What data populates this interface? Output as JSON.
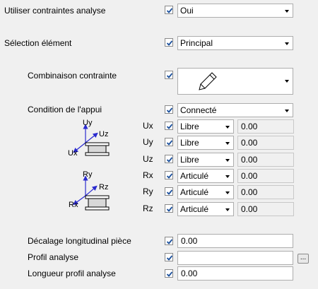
{
  "rows": {
    "use_constraints": {
      "label": "Utiliser contraintes analyse",
      "value": "Oui"
    },
    "element_selection": {
      "label": "Sélection élément",
      "value": "Principal"
    },
    "constraint_combination": {
      "label": "Combinaison contrainte",
      "icon": "pencil-icon"
    },
    "support_condition": {
      "label": "Condition de l'appui",
      "value": "Connecté"
    },
    "longitudinal_offset": {
      "label": "Décalage longitudinal pièce",
      "value": "0.00"
    },
    "analysis_profile": {
      "label": "Profil analyse",
      "value": "",
      "button": "..."
    },
    "analysis_profile_length": {
      "label": "Longueur profil analyse",
      "value": "0.00"
    }
  },
  "diagrams": {
    "translation": {
      "up": "Uy",
      "diag": "Uz",
      "left": "Ux"
    },
    "rotation": {
      "up": "Ry",
      "diag": "Rz",
      "left": "Rx"
    }
  },
  "dofs": [
    {
      "name": "Ux",
      "value": "Libre",
      "number": "0.00"
    },
    {
      "name": "Uy",
      "value": "Libre",
      "number": "0.00"
    },
    {
      "name": "Uz",
      "value": "Libre",
      "number": "0.00"
    },
    {
      "name": "Rx",
      "value": "Articulé",
      "number": "0.00"
    },
    {
      "name": "Ry",
      "value": "Articulé",
      "number": "0.00"
    },
    {
      "name": "Rz",
      "value": "Articulé",
      "number": "0.00"
    }
  ],
  "colors": {
    "checkmark": "#1a4f9c",
    "axis_arrow": "#2a2acf"
  }
}
